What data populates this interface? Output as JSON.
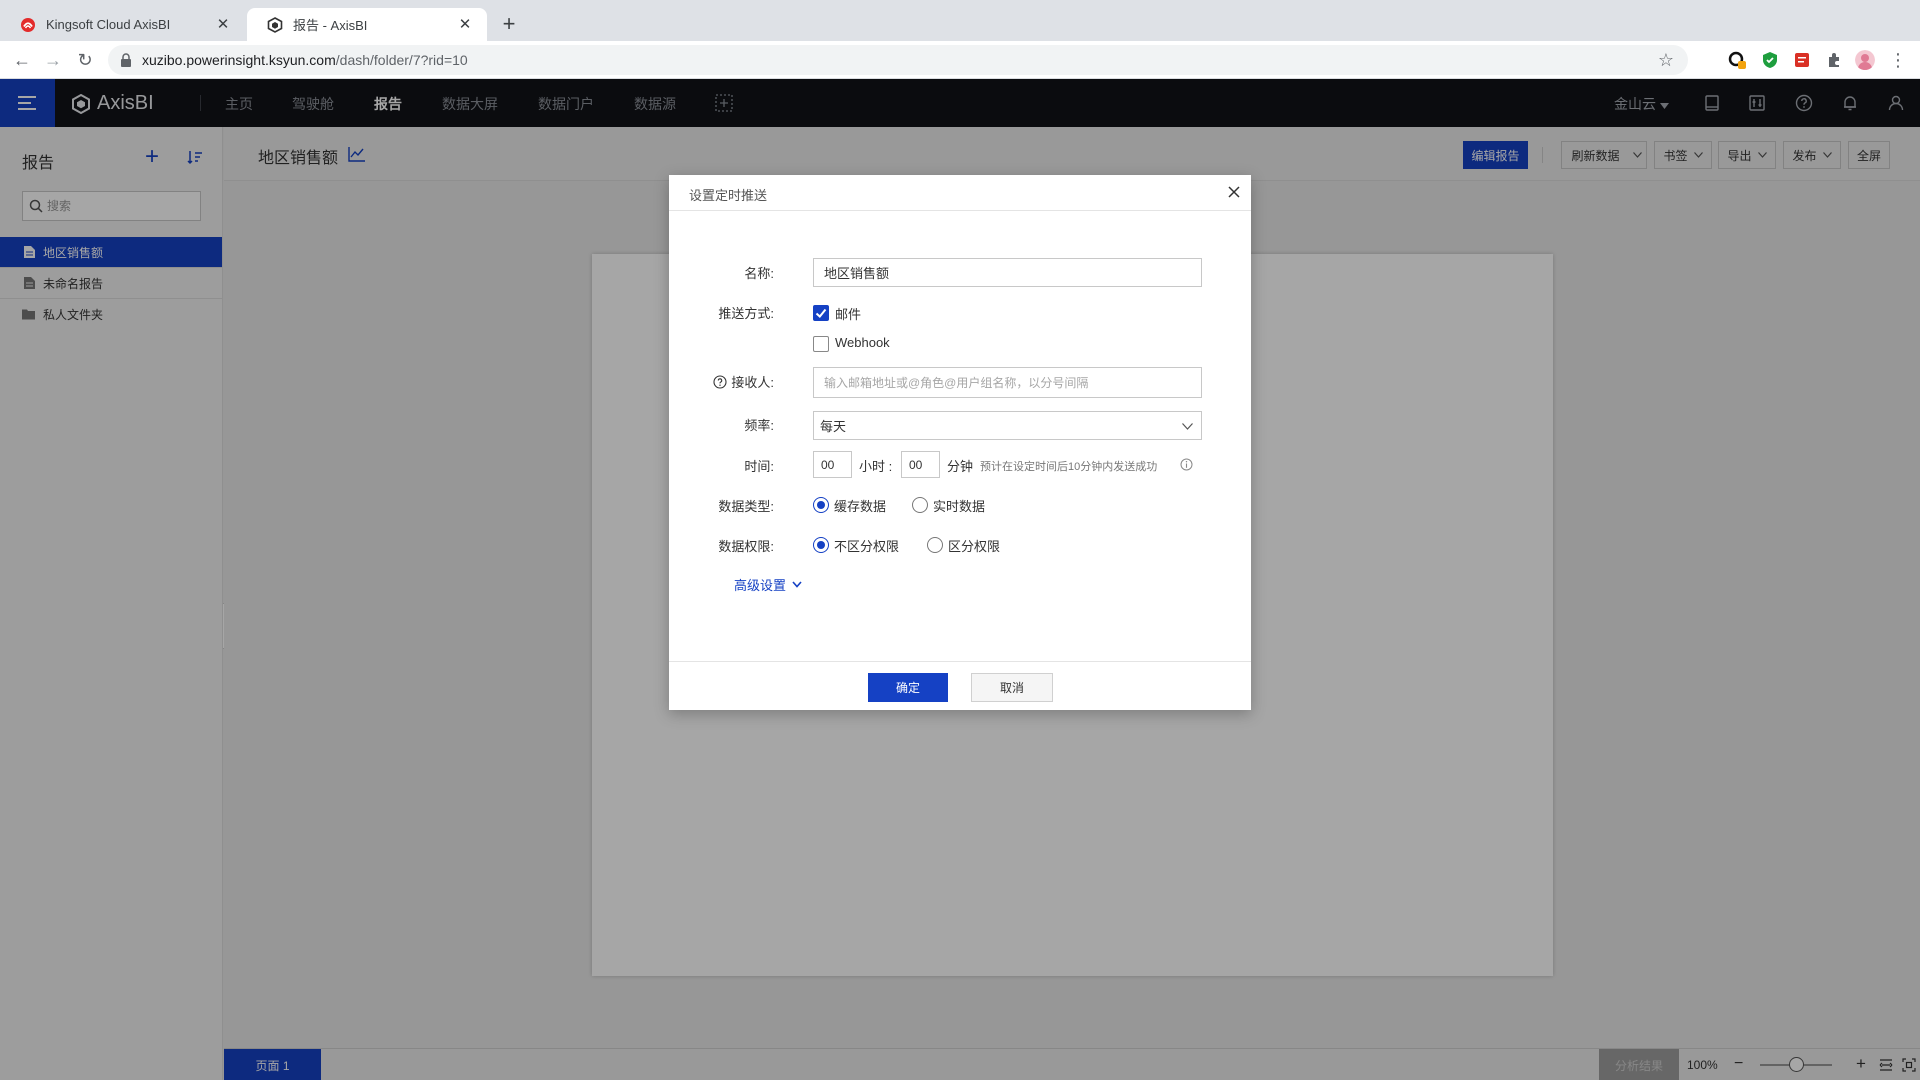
{
  "browser": {
    "tabs": [
      {
        "title": "Kingsoft Cloud AxisBI",
        "active": false
      },
      {
        "title": "报告 - AxisBI",
        "active": true
      }
    ],
    "url_host": "xuzibo.powerinsight.ksyun.com",
    "url_path": "/dash/folder/7?rid=10"
  },
  "app": {
    "brand": "AxisBI",
    "nav": [
      "主页",
      "驾驶舱",
      "报告",
      "数据大屏",
      "数据门户",
      "数据源"
    ],
    "active_nav": "报告",
    "org": "金山云"
  },
  "sidebar": {
    "title": "报告",
    "search_placeholder": "搜索",
    "items": [
      {
        "label": "地区销售额",
        "type": "report",
        "active": true
      },
      {
        "label": "未命名报告",
        "type": "report",
        "active": false
      },
      {
        "label": "私人文件夹",
        "type": "folder",
        "active": false
      }
    ]
  },
  "report": {
    "title": "地区销售额",
    "buttons": {
      "edit": "编辑报告",
      "refresh": "刷新数据",
      "bookmark": "书签",
      "export": "导出",
      "publish": "发布",
      "fullscreen": "全屏"
    }
  },
  "status": {
    "page_tab": "页面 1",
    "analysis": "分析结果",
    "zoom": "100%",
    "zoom_level": 0.5
  },
  "dialog": {
    "title": "设置定时推送",
    "name_label": "名称:",
    "name_value": "地区销售额",
    "push_label": "推送方式:",
    "push_email": "邮件",
    "push_email_checked": true,
    "push_webhook": "Webhook",
    "push_webhook_checked": false,
    "recipient_label": "接收人:",
    "recipient_placeholder": "输入邮箱地址或@角色@用户组名称，以分号间隔",
    "frequency_label": "频率:",
    "frequency_value": "每天",
    "time_label": "时间:",
    "hour_value": "00",
    "hour_unit": "小时 :",
    "minute_value": "00",
    "minute_unit": "分钟",
    "time_hint": "预计在设定时间后10分钟内发送成功",
    "datatype_label": "数据类型:",
    "datatype_cache": "缓存数据",
    "datatype_realtime": "实时数据",
    "datatype_selected": "缓存数据",
    "permission_label": "数据权限:",
    "permission_none": "不区分权限",
    "permission_split": "区分权限",
    "permission_selected": "不区分权限",
    "advanced": "高级设置",
    "ok": "确定",
    "cancel": "取消"
  },
  "colors": {
    "accent": "#1541c4",
    "header_bg": "#111318"
  }
}
